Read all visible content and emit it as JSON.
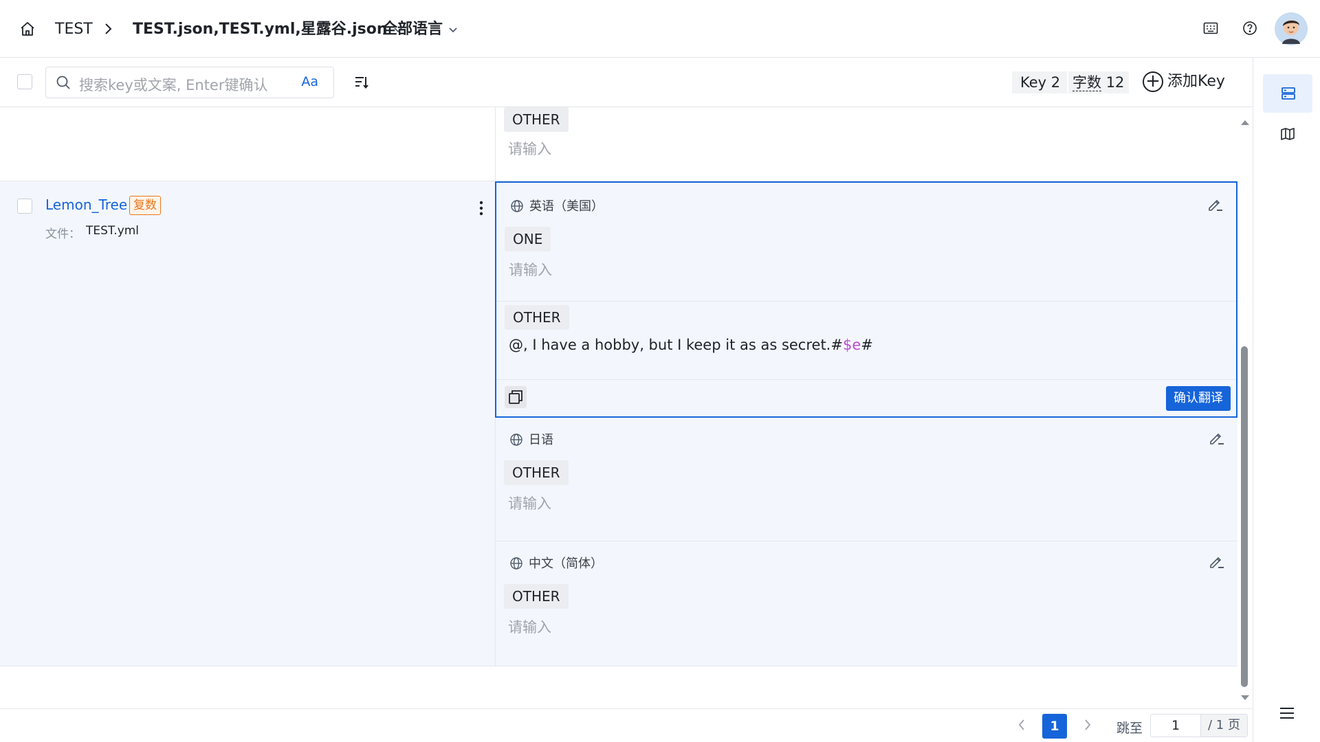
{
  "header": {
    "breadcrumb_project": "TEST",
    "breadcrumb_files": "TEST.json,TEST.yml,星露谷.json",
    "language_filter": "全部语言"
  },
  "toolbar": {
    "search_placeholder": "搜索key或文案, Enter键确认",
    "case_toggle": "Aa",
    "key_count_label": "Key",
    "key_count": "2",
    "word_count_label": "字数",
    "word_count": "12",
    "add_key_label": "添加Key"
  },
  "entries": {
    "prev": {
      "tag": "OTHER",
      "placeholder": "请输入"
    },
    "lemon": {
      "key": "Lemon_Tree",
      "badge": "复数",
      "file_label": "文件：",
      "file_name": "TEST.yml",
      "translations": {
        "en_us": {
          "language": "英语（美国）",
          "one_tag": "ONE",
          "one_placeholder": "请输入",
          "other_tag": "OTHER",
          "other_text_prefix": "@, I have a hobby, but I keep it as as secret.#",
          "other_variable": "$e",
          "other_text_suffix": "#",
          "confirm_button": "确认翻译"
        },
        "ja": {
          "language": "日语",
          "other_tag": "OTHER",
          "placeholder": "请输入"
        },
        "zh_cn": {
          "language": "中文（简体）",
          "other_tag": "OTHER",
          "placeholder": "请输入"
        }
      }
    }
  },
  "pagination": {
    "current_page": "1",
    "jump_label": "跳至",
    "jump_value": "1",
    "total_label": "/ 1 页"
  },
  "colors": {
    "accent": "#1664d9",
    "row_highlight": "#f3f7fd",
    "badge_orange": "#e8761b",
    "variable_pink": "#c04bd4"
  }
}
